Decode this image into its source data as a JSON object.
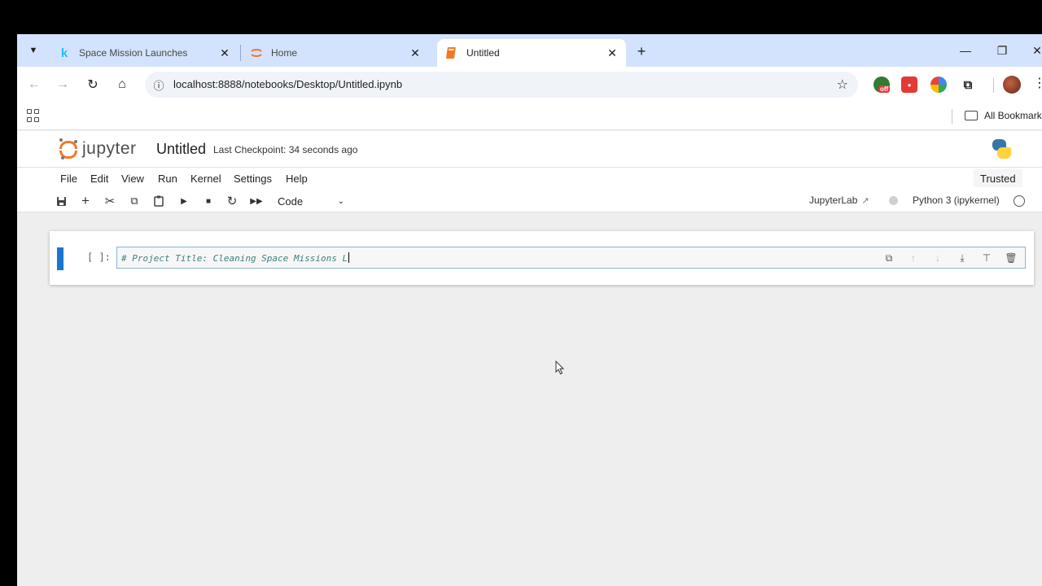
{
  "browser": {
    "tabs": [
      {
        "title": "Space Mission Launches",
        "favicon": "kaggle-k",
        "active": false
      },
      {
        "title": "Home",
        "favicon": "jupyter-ring",
        "active": false
      },
      {
        "title": "Untitled",
        "favicon": "notebook-book",
        "active": true
      }
    ],
    "new_tab_label": "+",
    "url": "localhost:8888/notebooks/Desktop/Untitled.ipynb",
    "bookmarks_all_label": "All Bookmarks",
    "extension_badge": "off",
    "colors": {
      "tabstrip": "#d3e3fd",
      "omnibox": "#f0f3f8"
    }
  },
  "jupyter": {
    "logo_text": "jupyter",
    "notebook_title": "Untitled",
    "checkpoint": "Last Checkpoint: 34 seconds ago",
    "menu": [
      "File",
      "Edit",
      "View",
      "Run",
      "Kernel",
      "Settings",
      "Help"
    ],
    "trusted_label": "Trusted",
    "cell_type": "Code",
    "jupyterlab_link": "JupyterLab",
    "kernel_name": "Python 3 (ipykernel)",
    "accent": "#f37726"
  },
  "notebook": {
    "cells": [
      {
        "prompt": "[ ]:",
        "source": "# Project Title: Cleaning Space Missions L",
        "type": "code"
      }
    ]
  }
}
